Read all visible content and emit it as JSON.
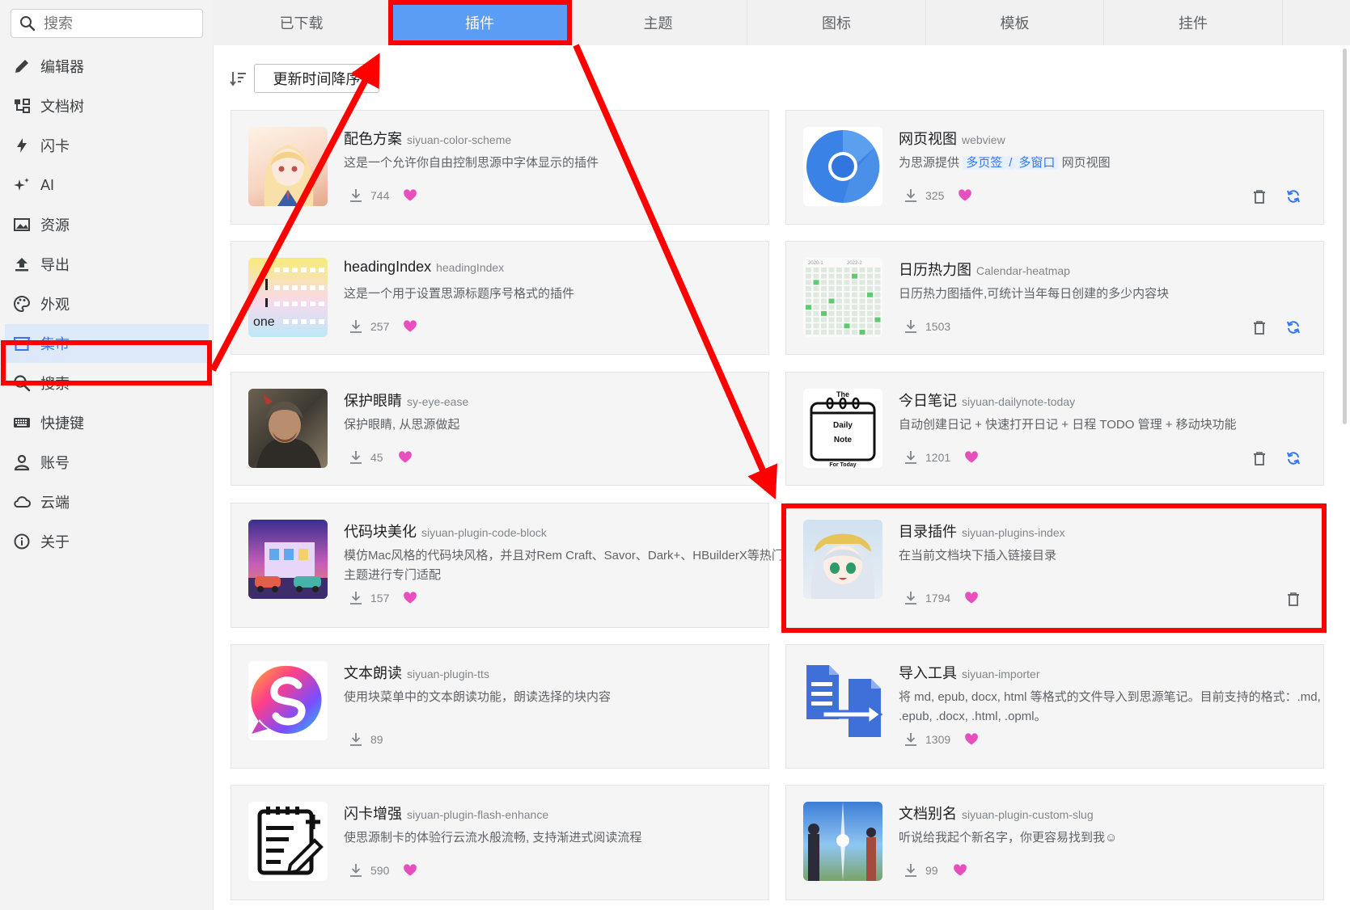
{
  "sidebar": {
    "search_placeholder": "搜索",
    "items": [
      {
        "label": "编辑器",
        "icon": "pencil-icon"
      },
      {
        "label": "文档树",
        "icon": "tree-icon"
      },
      {
        "label": "闪卡",
        "icon": "bolt-icon"
      },
      {
        "label": "AI",
        "icon": "sparkle-icon"
      },
      {
        "label": "资源",
        "icon": "image-icon"
      },
      {
        "label": "导出",
        "icon": "upload-icon"
      },
      {
        "label": "外观",
        "icon": "palette-icon"
      },
      {
        "label": "集市",
        "icon": "store-icon",
        "active": true
      },
      {
        "label": "搜索",
        "icon": "search-icon"
      },
      {
        "label": "快捷键",
        "icon": "keyboard-icon"
      },
      {
        "label": "账号",
        "icon": "user-icon"
      },
      {
        "label": "云端",
        "icon": "cloud-icon"
      },
      {
        "label": "关于",
        "icon": "info-icon"
      }
    ]
  },
  "tabs": [
    {
      "label": "已下载"
    },
    {
      "label": "插件",
      "active": true
    },
    {
      "label": "主题"
    },
    {
      "label": "图标"
    },
    {
      "label": "模板"
    },
    {
      "label": "挂件"
    }
  ],
  "sort": {
    "label": "更新时间降序"
  },
  "plugins": [
    {
      "title": "配色方案",
      "slug": "siyuan-color-scheme",
      "desc": "这是一个允许你自由控制思源中字体显示的插件",
      "downloads": "744",
      "liked": true,
      "installed": false
    },
    {
      "title": "网页视图",
      "slug": "webview",
      "desc_prefix": "为思源提供",
      "tag1": "多页签",
      "tag_sep": "/",
      "tag2": "多窗口",
      "desc_suffix": "网页视图",
      "downloads": "325",
      "liked": true,
      "installed": true,
      "update": true
    },
    {
      "title": "headingIndex",
      "slug": "headingIndex",
      "desc": "这是一个用于设置思源标题序号格式的插件",
      "downloads": "257",
      "liked": true,
      "installed": false,
      "thumb_text": "one"
    },
    {
      "title": "日历热力图",
      "slug": "Calendar-heatmap",
      "desc": "日历热力图插件,可统计当年每日创建的多少内容块",
      "downloads": "1503",
      "liked": false,
      "installed": true,
      "update": true,
      "thumb_labels": [
        "2020-1",
        "2022-2"
      ]
    },
    {
      "title": "保护眼睛",
      "slug": "sy-eye-ease",
      "desc": "保护眼睛, 从思源做起",
      "downloads": "45",
      "liked": true,
      "installed": false
    },
    {
      "title": "今日笔记",
      "slug": "siyuan-dailynote-today",
      "desc": "自动创建日记 + 快速打开日记 + 日程 TODO 管理 + 移动块功能",
      "downloads": "1201",
      "liked": true,
      "installed": true,
      "update": true,
      "thumb_lines": [
        "The",
        "Daily",
        "Note",
        "For Today"
      ]
    },
    {
      "title": "代码块美化",
      "slug": "siyuan-plugin-code-block",
      "desc": "模仿Mac风格的代码块风格，并且对Rem Craft、Savor、Dark+、HBuilderX等热门主题进行专门适配",
      "downloads": "157",
      "liked": true,
      "installed": false
    },
    {
      "title": "目录插件",
      "slug": "siyuan-plugins-index",
      "desc": "在当前文档块下插入链接目录",
      "downloads": "1794",
      "liked": true,
      "installed": true,
      "update": false
    },
    {
      "title": "文本朗读",
      "slug": "siyuan-plugin-tts",
      "desc": "使用块菜单中的文本朗读功能，朗读选择的块内容",
      "downloads": "89",
      "liked": false,
      "installed": false
    },
    {
      "title": "导入工具",
      "slug": "siyuan-importer",
      "desc": "将 md, epub, docx, html 等格式的文件导入到思源笔记。目前支持的格式：.md, .epub, .docx, .html, .opml。",
      "downloads": "1309",
      "liked": true,
      "installed": false
    },
    {
      "title": "闪卡增强",
      "slug": "siyuan-plugin-flash-enhance",
      "desc": "使思源制卡的体验行云流水般流畅, 支持渐进式阅读流程",
      "downloads": "590",
      "liked": true,
      "installed": false
    },
    {
      "title": "文档别名",
      "slug": "siyuan-plugin-custom-slug",
      "desc": "听说给我起个新名字，你更容易找到我☺",
      "downloads": "99",
      "liked": true,
      "installed": false
    }
  ],
  "colors": {
    "accent": "#3576f0",
    "tab_active": "#5b9df5",
    "heart": "#e84fbe",
    "annotation": "#ff0000"
  }
}
